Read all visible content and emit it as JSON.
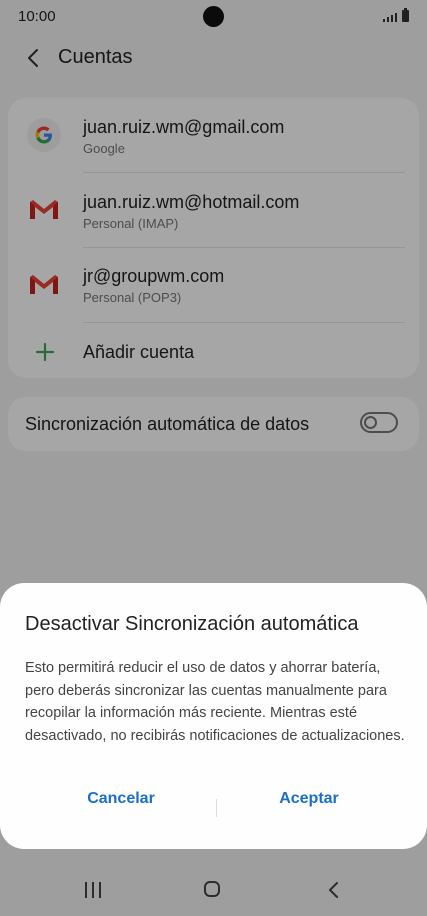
{
  "status": {
    "time": "10:00"
  },
  "header": {
    "title": "Cuentas"
  },
  "accounts": [
    {
      "email": "juan.ruiz.wm@gmail.com",
      "type": "Google",
      "icon": "google-icon"
    },
    {
      "email": "juan.ruiz.wm@hotmail.com",
      "type": "Personal (IMAP)",
      "icon": "gmail-icon"
    },
    {
      "email": "jr@groupwm.com",
      "type": "Personal (POP3)",
      "icon": "gmail-icon"
    }
  ],
  "add_account": {
    "label": "Añadir cuenta"
  },
  "sync": {
    "label": "Sincronización automática de datos",
    "enabled": false
  },
  "dialog": {
    "title": "Desactivar Sincronización automática",
    "body": "Esto permitirá reducir el uso de datos y ahorrar batería, pero deberás sincronizar las cuentas manualmente para recopilar la información más reciente. Mientras esté desactivado, no recibirás notificaciones de actualizaciones.",
    "cancel_label": "Cancelar",
    "accept_label": "Aceptar"
  },
  "colors": {
    "accent": "#1a70c8",
    "google_red": "#ea4335",
    "add_green": "#3aa757"
  }
}
